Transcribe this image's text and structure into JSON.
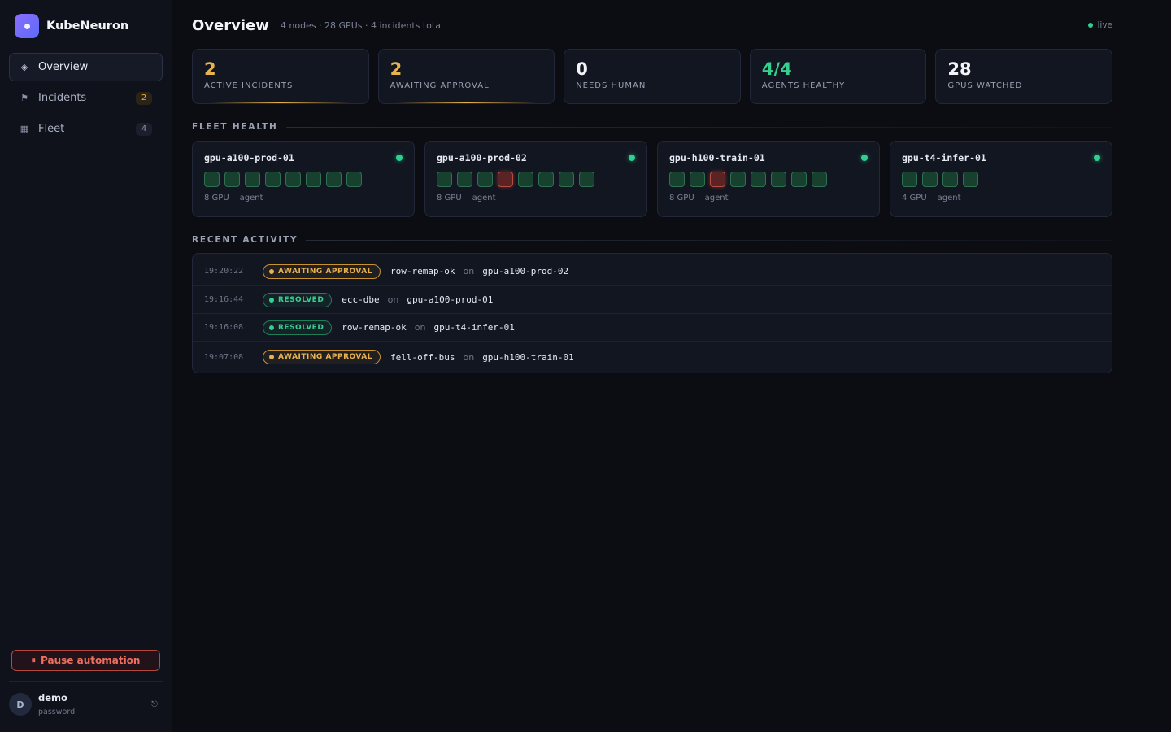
{
  "brand": {
    "name": "KubeNeuron"
  },
  "nav": [
    {
      "label": "Overview",
      "icon": "diamond-icon",
      "count": null,
      "active": true
    },
    {
      "label": "Incidents",
      "icon": "flag-icon",
      "count": "2",
      "active": false
    },
    {
      "label": "Fleet",
      "icon": "grid-icon",
      "count": "4",
      "active": false
    }
  ],
  "pause_button": {
    "label": "Pause automation",
    "icon": "pause-icon"
  },
  "user": {
    "avatar": "D",
    "name": "demo",
    "sub": "password",
    "logout_icon": "logout-icon"
  },
  "header": {
    "title": "Overview",
    "subtitle": "4 nodes · 28 GPUs · 4 incidents total",
    "live_label": "live"
  },
  "stats": [
    {
      "value": "2",
      "label": "ACTIVE INCIDENTS",
      "color": "#eab24f"
    },
    {
      "value": "2",
      "label": "AWAITING APPROVAL",
      "color": "#eab24f"
    },
    {
      "value": "0",
      "label": "NEEDS HUMAN",
      "color": "#f2f4f8"
    },
    {
      "value": "4/4",
      "label": "AGENTS HEALTHY",
      "color": "#35cf8f"
    },
    {
      "value": "28",
      "label": "GPUS WATCHED",
      "color": "#f2f4f8"
    }
  ],
  "fleet_health": {
    "title": "FLEET HEALTH",
    "nodes": [
      {
        "name": "gpu-a100-prod-01",
        "gpu_label": "8 GPU",
        "agent_label": "agent",
        "gpus": [
          "ok",
          "ok",
          "ok",
          "ok",
          "ok",
          "ok",
          "ok",
          "ok"
        ]
      },
      {
        "name": "gpu-a100-prod-02",
        "gpu_label": "8 GPU",
        "agent_label": "agent",
        "gpus": [
          "ok",
          "ok",
          "ok",
          "bad",
          "ok",
          "ok",
          "ok",
          "ok"
        ]
      },
      {
        "name": "gpu-h100-train-01",
        "gpu_label": "8 GPU",
        "agent_label": "agent",
        "gpus": [
          "ok",
          "ok",
          "bad",
          "ok",
          "ok",
          "ok",
          "ok",
          "ok"
        ]
      },
      {
        "name": "gpu-t4-infer-01",
        "gpu_label": "4 GPU",
        "agent_label": "agent",
        "gpus": [
          "ok",
          "ok",
          "ok",
          "ok"
        ]
      }
    ]
  },
  "recent_activity": {
    "title": "RECENT ACTIVITY",
    "rows": [
      {
        "time": "19:20:22",
        "status": "AWAITING APPROVAL",
        "kind": "awaiting",
        "check": "row-remap-ok",
        "on": "on",
        "node": "gpu-a100-prod-02"
      },
      {
        "time": "19:16:44",
        "status": "RESOLVED",
        "kind": "resolved",
        "check": "ecc-dbe",
        "on": "on",
        "node": "gpu-a100-prod-01"
      },
      {
        "time": "19:16:08",
        "status": "RESOLVED",
        "kind": "resolved",
        "check": "row-remap-ok",
        "on": "on",
        "node": "gpu-t4-infer-01"
      },
      {
        "time": "19:07:08",
        "status": "AWAITING APPROVAL",
        "kind": "awaiting",
        "check": "fell-off-bus",
        "on": "on",
        "node": "gpu-h100-train-01"
      }
    ]
  }
}
